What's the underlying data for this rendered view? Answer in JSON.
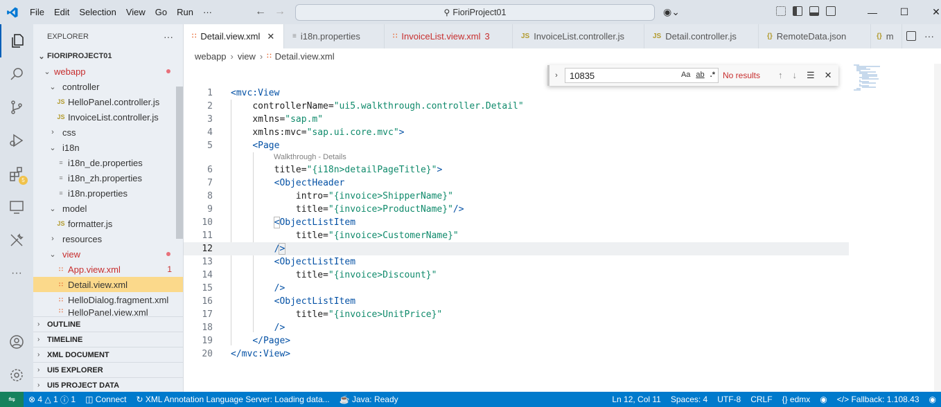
{
  "titlebar": {
    "menu": [
      "File",
      "Edit",
      "Selection",
      "View",
      "Go",
      "Run",
      "···"
    ],
    "search_text": "FioriProject01"
  },
  "sidebar": {
    "title": "EXPLORER",
    "more": "···",
    "root": "FIORIPROJECT01",
    "tree": [
      {
        "label": "webapp",
        "kind": "folder"
      },
      {
        "label": "controller",
        "kind": "folder"
      },
      {
        "label": "HelloPanel.controller.js",
        "kind": "js"
      },
      {
        "label": "InvoiceList.controller.js",
        "kind": "js"
      },
      {
        "label": "css",
        "kind": "folder"
      },
      {
        "label": "i18n",
        "kind": "folder"
      },
      {
        "label": "i18n_de.properties",
        "kind": "prop"
      },
      {
        "label": "i18n_zh.properties",
        "kind": "prop"
      },
      {
        "label": "i18n.properties",
        "kind": "prop"
      },
      {
        "label": "model",
        "kind": "folder"
      },
      {
        "label": "formatter.js",
        "kind": "js"
      },
      {
        "label": "resources",
        "kind": "folder"
      },
      {
        "label": "view",
        "kind": "folder"
      },
      {
        "label": "App.view.xml",
        "kind": "xml",
        "count": "1"
      },
      {
        "label": "Detail.view.xml",
        "kind": "xml"
      },
      {
        "label": "HelloDialog.fragment.xml",
        "kind": "xml"
      },
      {
        "label": "HelloPanel.view.xml",
        "kind": "xml"
      }
    ],
    "panels": [
      "OUTLINE",
      "TIMELINE",
      "XML DOCUMENT",
      "UI5 EXPLORER",
      "UI5 PROJECT DATA"
    ]
  },
  "tabs": [
    {
      "label": "Detail.view.xml",
      "icon": "xml",
      "active": true
    },
    {
      "label": "i18n.properties",
      "icon": "prop"
    },
    {
      "label": "InvoiceList.view.xml",
      "icon": "xml",
      "count": "3"
    },
    {
      "label": "InvoiceList.controller.js",
      "icon": "js"
    },
    {
      "label": "Detail.controller.js",
      "icon": "js"
    },
    {
      "label": "RemoteData.json",
      "icon": "json"
    },
    {
      "label": "m",
      "icon": "json"
    }
  ],
  "breadcrumb": [
    "webapp",
    "view",
    "Detail.view.xml"
  ],
  "find": {
    "query": "10835",
    "opt_case": "Aa",
    "opt_word": "ab",
    "opt_regex": ".*",
    "result": "No results"
  },
  "code": {
    "inlay_hint": "Walkthrough - Details",
    "line_numbers": [
      "1",
      "2",
      "3",
      "4",
      "5",
      "6",
      "7",
      "8",
      "9",
      "10",
      "11",
      "12",
      "13",
      "14",
      "15",
      "16",
      "17",
      "18",
      "19",
      "20"
    ]
  },
  "status": {
    "problems": "4",
    "warnings": "1",
    "info": "1",
    "connect": "Connect",
    "xml_server": "XML Annotation Language Server: Loading data...",
    "java": "Java: Ready",
    "position": "Ln 12, Col 11",
    "spaces": "Spaces: 4",
    "encoding": "UTF-8",
    "eol": "CRLF",
    "language": "edmx",
    "fallback": "Fallback: 1.108.43"
  }
}
